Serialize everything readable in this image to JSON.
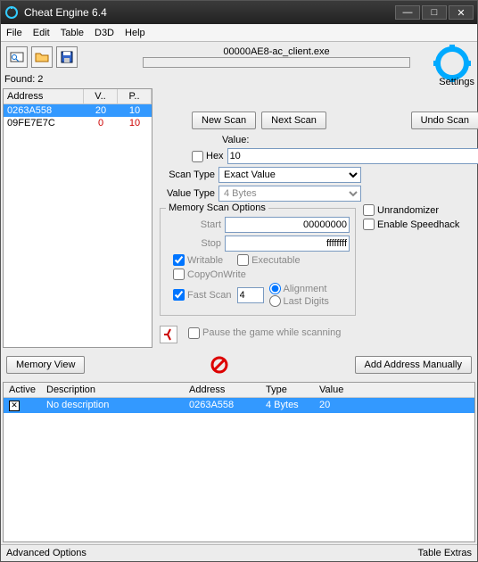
{
  "title": "Cheat Engine 6.4",
  "menu": {
    "file": "File",
    "edit": "Edit",
    "table": "Table",
    "d3d": "D3D",
    "help": "Help"
  },
  "process": "00000AE8-ac_client.exe",
  "found_label": "Found: 2",
  "cols": {
    "address": "Address",
    "v": "V..",
    "p": "P.."
  },
  "results": [
    {
      "addr": "0263A558",
      "v": "20",
      "p": "10",
      "sel": true
    },
    {
      "addr": "09FE7E7C",
      "v": "0",
      "p": "10",
      "sel": false
    }
  ],
  "buttons": {
    "newscan": "New Scan",
    "nextscan": "Next Scan",
    "undoscan": "Undo Scan",
    "memview": "Memory View",
    "addmanual": "Add Address Manually"
  },
  "settings_label": "Settings",
  "labels": {
    "value": "Value:",
    "hex": "Hex",
    "scantype": "Scan Type",
    "valuetype": "Value Type",
    "memopts": "Memory Scan Options",
    "start": "Start",
    "stop": "Stop",
    "writable": "Writable",
    "executable": "Executable",
    "cow": "CopyOnWrite",
    "fastscan": "Fast Scan",
    "alignment": "Alignment",
    "lastdigits": "Last Digits",
    "pause": "Pause the game while scanning",
    "unrandom": "Unrandomizer",
    "speedhack": "Enable Speedhack"
  },
  "values": {
    "value": "10",
    "scantype": "Exact Value",
    "valuetype": "4 Bytes",
    "start": "00000000",
    "stop": "ffffffff",
    "fastscan": "4"
  },
  "tablecols": {
    "active": "Active",
    "desc": "Description",
    "addr": "Address",
    "type": "Type",
    "val": "Value"
  },
  "tablerow": {
    "desc": "No description",
    "addr": "0263A558",
    "type": "4 Bytes",
    "val": "20"
  },
  "status": {
    "adv": "Advanced Options",
    "extras": "Table Extras"
  }
}
